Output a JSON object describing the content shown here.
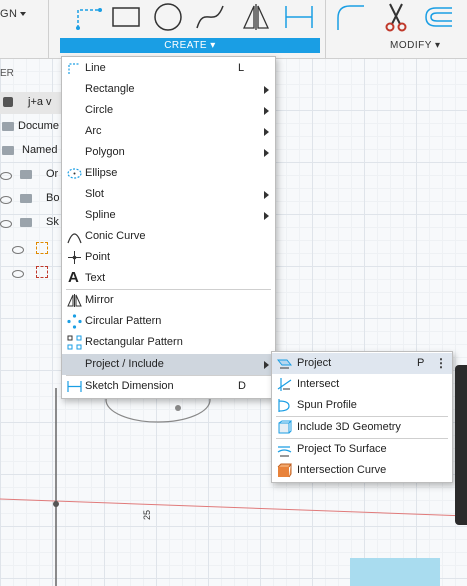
{
  "toolbar": {
    "left_label": "GN",
    "create_label": "CREATE ▾",
    "modify_label": "MODIFY ▾",
    "tools": [
      "line-tool-icon",
      "rectangle-tool-icon",
      "circle-tool-icon",
      "spline-tool-icon",
      "mirror-tool-icon",
      "dimension-tool-icon",
      "fillet-tool-icon",
      "trim-tool-icon",
      "offset-tool-icon"
    ]
  },
  "browser": {
    "header": "ER",
    "rows": [
      {
        "label": "j+a v"
      },
      {
        "label": "Docume"
      },
      {
        "label": "Named"
      },
      {
        "label": "Or"
      },
      {
        "label": "Bo"
      },
      {
        "label": "Sk"
      }
    ]
  },
  "menu": {
    "items": [
      {
        "label": "Line",
        "shortcut": "L",
        "icon": "line-icon"
      },
      {
        "label": "Rectangle",
        "submenu": true,
        "icon": ""
      },
      {
        "label": "Circle",
        "submenu": true,
        "icon": ""
      },
      {
        "label": "Arc",
        "submenu": true,
        "icon": ""
      },
      {
        "label": "Polygon",
        "submenu": true,
        "icon": ""
      },
      {
        "label": "Ellipse",
        "icon": "ellipse-icon"
      },
      {
        "label": "Slot",
        "submenu": true,
        "icon": ""
      },
      {
        "label": "Spline",
        "submenu": true,
        "icon": ""
      },
      {
        "label": "Conic Curve",
        "icon": "conic-curve-icon"
      },
      {
        "label": "Point",
        "icon": "point-icon"
      },
      {
        "label": "Text",
        "icon": "text-icon"
      },
      {
        "label": "Mirror",
        "icon": "mirror-icon"
      },
      {
        "label": "Circular Pattern",
        "icon": "circular-pattern-icon"
      },
      {
        "label": "Rectangular Pattern",
        "icon": "rectangular-pattern-icon"
      },
      {
        "label": "Project / Include",
        "submenu": true,
        "highlighted": true,
        "icon": ""
      },
      {
        "label": "Sketch Dimension",
        "shortcut": "D",
        "icon": "sketch-dimension-icon"
      }
    ]
  },
  "submenu": {
    "items": [
      {
        "label": "Project",
        "shortcut": "P",
        "icon": "project-icon"
      },
      {
        "label": "Intersect",
        "icon": "intersect-icon"
      },
      {
        "label": "Spun Profile",
        "icon": "spun-profile-icon"
      },
      {
        "label": "Include 3D Geometry",
        "icon": "include-3d-geometry-icon"
      },
      {
        "label": "Project To Surface",
        "icon": "project-to-surface-icon"
      },
      {
        "label": "Intersection Curve",
        "icon": "intersection-curve-icon"
      }
    ]
  },
  "canvas": {
    "dimension_text": "25"
  },
  "colors": {
    "accent": "#1a9ee4",
    "highlight": "#cfd6de"
  }
}
